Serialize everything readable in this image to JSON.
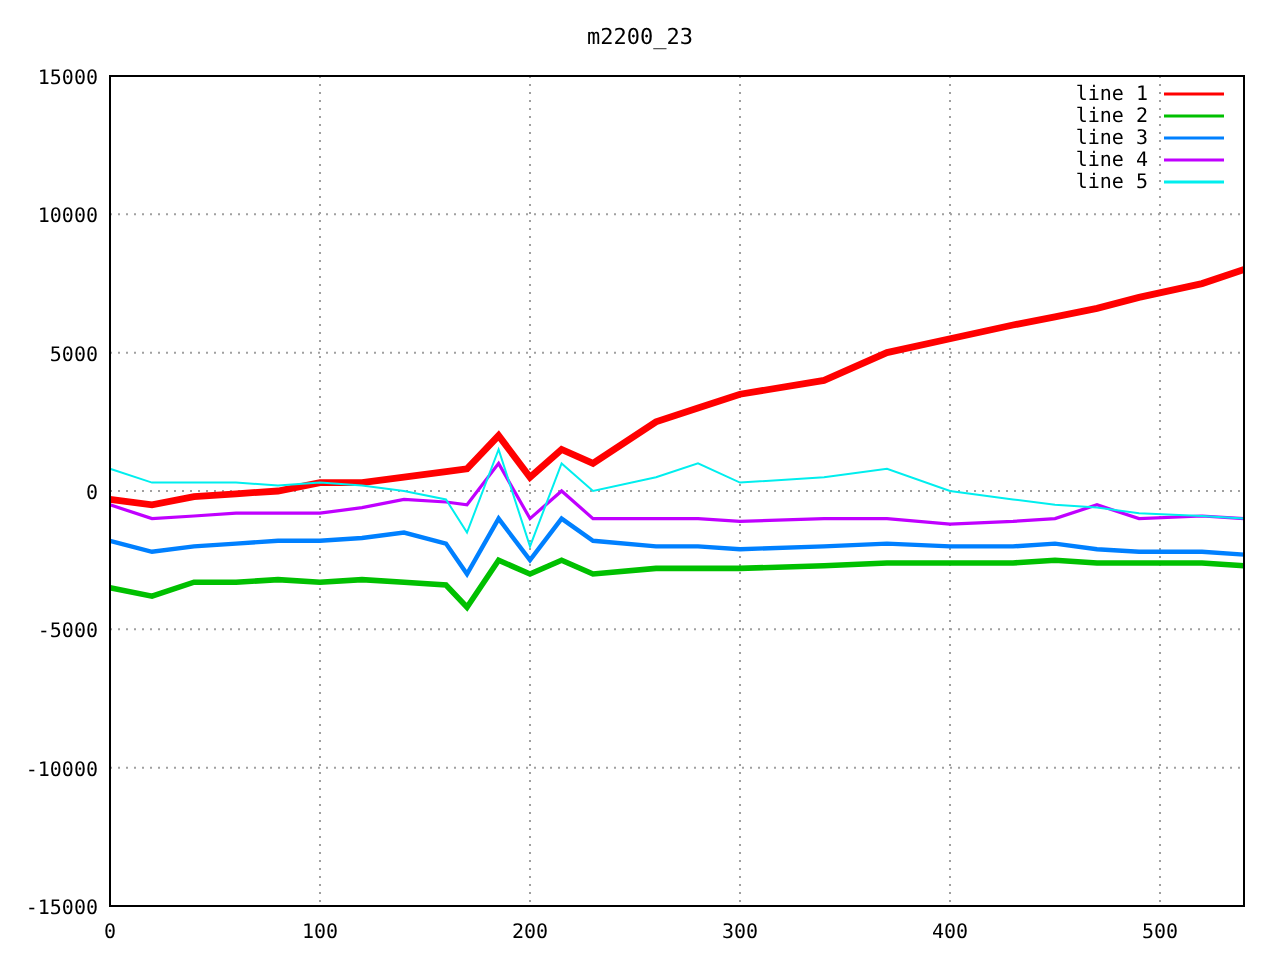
{
  "chart_data": {
    "type": "line",
    "title": "m2200_23",
    "x": [
      0,
      20,
      40,
      60,
      80,
      100,
      120,
      140,
      160,
      170,
      185,
      200,
      215,
      230,
      260,
      280,
      300,
      340,
      370,
      400,
      430,
      450,
      470,
      490,
      520,
      540
    ],
    "series": [
      {
        "name": "line 1",
        "color": "#ff0000",
        "values": [
          -300,
          -500,
          -200,
          -100,
          0,
          300,
          300,
          500,
          700,
          800,
          2000,
          500,
          1500,
          1000,
          2500,
          3000,
          3500,
          4000,
          5000,
          5500,
          6000,
          6300,
          6600,
          7000,
          7500,
          8000
        ]
      },
      {
        "name": "line 2",
        "color": "#00c000",
        "values": [
          -3500,
          -3800,
          -3300,
          -3300,
          -3200,
          -3300,
          -3200,
          -3300,
          -3400,
          -4200,
          -2500,
          -3000,
          -2500,
          -3000,
          -2800,
          -2800,
          -2800,
          -2700,
          -2600,
          -2600,
          -2600,
          -2500,
          -2600,
          -2600,
          -2600,
          -2700
        ]
      },
      {
        "name": "line 3",
        "color": "#0080ff",
        "values": [
          -1800,
          -2200,
          -2000,
          -1900,
          -1800,
          -1800,
          -1700,
          -1500,
          -1900,
          -3000,
          -1000,
          -2500,
          -1000,
          -1800,
          -2000,
          -2000,
          -2100,
          -2000,
          -1900,
          -2000,
          -2000,
          -1900,
          -2100,
          -2200,
          -2200,
          -2300
        ]
      },
      {
        "name": "line 4",
        "color": "#c000ff",
        "values": [
          -500,
          -1000,
          -900,
          -800,
          -800,
          -800,
          -600,
          -300,
          -400,
          -500,
          1000,
          -1000,
          0,
          -1000,
          -1000,
          -1000,
          -1100,
          -1000,
          -1000,
          -1200,
          -1100,
          -1000,
          -500,
          -1000,
          -900,
          -1000
        ]
      },
      {
        "name": "line 5",
        "color": "#00eeee",
        "values": [
          800,
          300,
          300,
          300,
          200,
          300,
          200,
          0,
          -300,
          -1500,
          1500,
          -2000,
          1000,
          0,
          500,
          1000,
          300,
          500,
          800,
          0,
          -300,
          -500,
          -600,
          -800,
          -900,
          -1000
        ]
      }
    ],
    "xlim": [
      0,
      540
    ],
    "ylim": [
      -15000,
      15000
    ],
    "xticks": [
      0,
      100,
      200,
      300,
      400,
      500
    ],
    "yticks": [
      -15000,
      -10000,
      -5000,
      0,
      5000,
      10000,
      15000
    ],
    "grid": true,
    "legend": true
  }
}
